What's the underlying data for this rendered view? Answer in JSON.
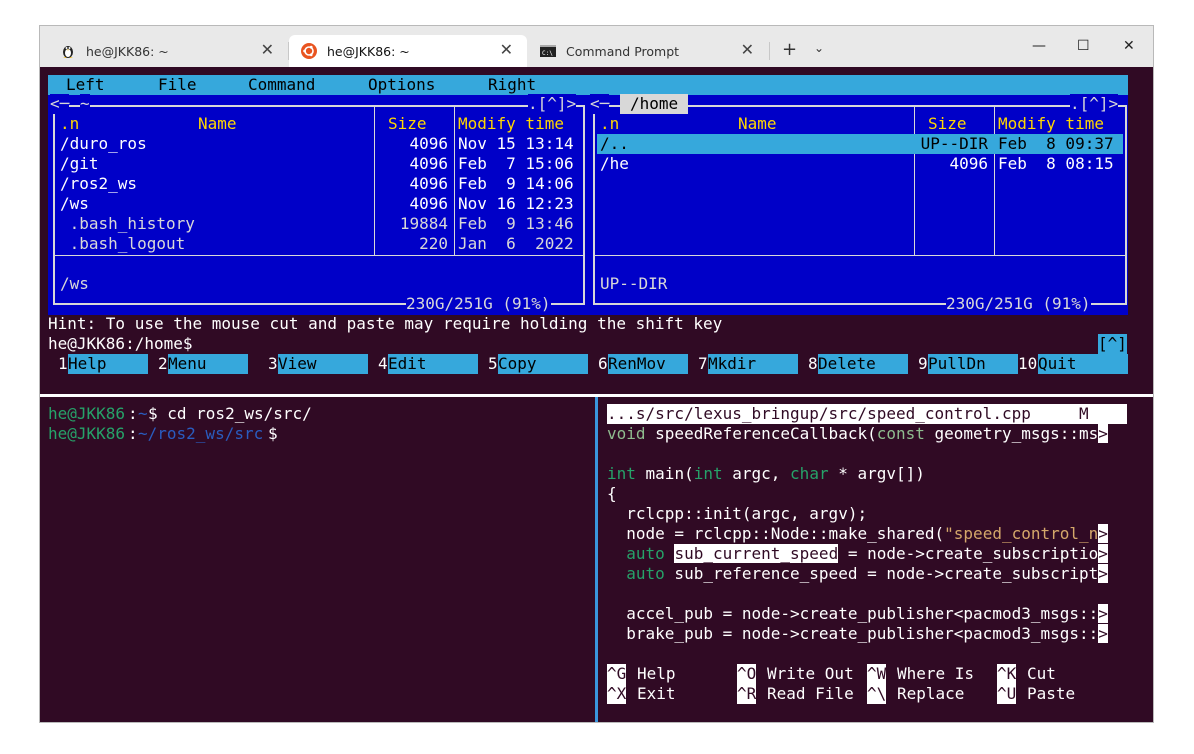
{
  "window": {
    "tabs": [
      {
        "label": "he@JKK86: ~",
        "icon": "linux-penguin-icon",
        "active": false
      },
      {
        "label": "he@JKK86: ~",
        "icon": "ubuntu-icon",
        "active": true
      },
      {
        "label": "Command Prompt",
        "icon": "cmd-icon",
        "active": false
      }
    ],
    "new_tab": "+",
    "dropdown": "⌄",
    "minimize": "—",
    "maximize": "☐",
    "close": "✕",
    "tab_close": "✕"
  },
  "mc": {
    "menu": [
      "Left",
      "File",
      "Command",
      "Options",
      "Right"
    ],
    "left_panel": {
      "path": "~",
      "corner": ".[^]>",
      "headers": {
        "n": ".n",
        "name": "Name",
        "size": "Size",
        "mtime": "Modify time"
      },
      "rows": [
        {
          "name": "/duro_ros",
          "size": "4096",
          "mtime": "Nov 15 13:14"
        },
        {
          "name": "/git",
          "size": "4096",
          "mtime": "Feb  7 15:06"
        },
        {
          "name": "/ros2_ws",
          "size": "4096",
          "mtime": "Feb  9 14:06"
        },
        {
          "name": "/ws",
          "size": "4096",
          "mtime": "Nov 16 12:23"
        },
        {
          "name": " .bash_history",
          "size": "19884",
          "mtime": "Feb  9 13:46"
        },
        {
          "name": " .bash_logout",
          "size": "220",
          "mtime": "Jan  6  2022"
        }
      ],
      "mini_status": "/ws",
      "disk": "230G/251G (91%)"
    },
    "right_panel": {
      "path": "/home",
      "corner": ".[^]>",
      "headers": {
        "n": ".n",
        "name": "Name",
        "size": "Size",
        "mtime": "Modify time"
      },
      "rows": [
        {
          "name": "/..",
          "size": "UP--DIR",
          "mtime": "Feb  8 09:37"
        },
        {
          "name": "/he",
          "size": "4096",
          "mtime": "Feb  8 08:15"
        }
      ],
      "mini_status": "UP--DIR",
      "disk": "230G/251G (91%)"
    },
    "hint": "Hint: To use the mouse cut and paste may require holding the shift key",
    "prompt": "he@JKK86:/home$",
    "prompt_corner": "[^]",
    "fkeys": [
      {
        "num": "1",
        "label": "Help"
      },
      {
        "num": "2",
        "label": "Menu"
      },
      {
        "num": "3",
        "label": "View"
      },
      {
        "num": "4",
        "label": "Edit"
      },
      {
        "num": "5",
        "label": "Copy"
      },
      {
        "num": "6",
        "label": "RenMov"
      },
      {
        "num": "7",
        "label": "Mkdir"
      },
      {
        "num": "8",
        "label": "Delete"
      },
      {
        "num": "9",
        "label": "PullDn"
      },
      {
        "num": "10",
        "label": "Quit"
      }
    ]
  },
  "shell": {
    "line1_user": "he@JKK86",
    "line1_colon": ":",
    "line1_path": "~",
    "line1_cmd": "$ cd ros2_ws/src/",
    "line2_user": "he@JKK86",
    "line2_colon": ":",
    "line2_path": "~/ros2_ws/src",
    "line2_prompt": "$"
  },
  "nano": {
    "header": "...s/src/lexus_bringup/src/speed_control.cpp     M",
    "lines": [
      {
        "a": "void",
        "b": " speedReferenceCallback(",
        "c": "const",
        "d": " geometry_msgs::ms",
        "e": ">"
      },
      {
        "blank": true
      },
      {
        "a": "int",
        "b": " main(",
        "c": "int",
        "d": " argc, ",
        "e": "char",
        "f": " * argv[])"
      },
      {
        "text": "{"
      },
      {
        "text": "  rclcpp::init(argc, argv);"
      },
      {
        "pre": "  node = rclcpp::Node::make_shared(",
        "str": "\"speed_control_n",
        "e": ">"
      },
      {
        "pre": "  ",
        "kw": "auto",
        "mid": " ",
        "sel": "sub_current_speed",
        "post": " = node->create_subscriptio",
        "e": ">"
      },
      {
        "pre": "  ",
        "kw": "auto",
        "mid": " sub_reference_speed = node->create_subscript",
        "e": ">"
      },
      {
        "blank": true
      },
      {
        "pre": "  accel_pub = node->create_publisher<pacmod3_msgs::",
        "e": ">"
      },
      {
        "pre": "  brake_pub = node->create_publisher<pacmod3_msgs::",
        "e": ">"
      }
    ],
    "shortcuts": [
      {
        "key": "^G",
        "label": "Help"
      },
      {
        "key": "^O",
        "label": "Write Out"
      },
      {
        "key": "^W",
        "label": "Where Is"
      },
      {
        "key": "^K",
        "label": "Cut"
      },
      {
        "key": "^X",
        "label": "Exit"
      },
      {
        "key": "^R",
        "label": "Read File"
      },
      {
        "key": "^\\",
        "label": "Replace"
      },
      {
        "key": "^U",
        "label": "Paste"
      }
    ]
  }
}
